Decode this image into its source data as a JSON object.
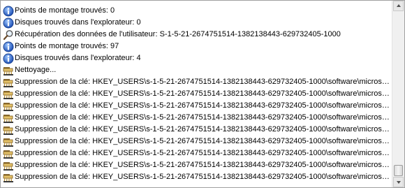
{
  "log": {
    "entries": [
      {
        "icon": "info-icon",
        "text": "Points de montage trouvés: 0"
      },
      {
        "icon": "info-icon",
        "text": "Disques trouvés dans l'explorateur: 0"
      },
      {
        "icon": "magnifier-icon",
        "text": "Récupération des données de l'utilisateur: S-1-5-21-2674751514-1382138443-629732405-1000"
      },
      {
        "icon": "info-icon",
        "text": "Points de montage trouvés: 97"
      },
      {
        "icon": "info-icon",
        "text": "Disques trouvés dans l'explorateur: 4"
      },
      {
        "icon": "broom-icon",
        "text": "Nettoyage..."
      },
      {
        "icon": "broom-icon",
        "text": "Suppression de la clé: HKEY_USERS\\s-1-5-21-2674751514-1382138443-629732405-1000\\software\\microsoft..."
      },
      {
        "icon": "broom-icon",
        "text": "Suppression de la clé: HKEY_USERS\\s-1-5-21-2674751514-1382138443-629732405-1000\\software\\microsoft..."
      },
      {
        "icon": "broom-icon",
        "text": "Suppression de la clé: HKEY_USERS\\s-1-5-21-2674751514-1382138443-629732405-1000\\software\\microsoft..."
      },
      {
        "icon": "broom-icon",
        "text": "Suppression de la clé: HKEY_USERS\\s-1-5-21-2674751514-1382138443-629732405-1000\\software\\microsoft..."
      },
      {
        "icon": "broom-icon",
        "text": "Suppression de la clé: HKEY_USERS\\s-1-5-21-2674751514-1382138443-629732405-1000\\software\\microsoft..."
      },
      {
        "icon": "broom-icon",
        "text": "Suppression de la clé: HKEY_USERS\\s-1-5-21-2674751514-1382138443-629732405-1000\\software\\microsoft..."
      },
      {
        "icon": "broom-icon",
        "text": "Suppression de la clé: HKEY_USERS\\s-1-5-21-2674751514-1382138443-629732405-1000\\software\\microsoft..."
      },
      {
        "icon": "broom-icon",
        "text": "Suppression de la clé: HKEY_USERS\\s-1-5-21-2674751514-1382138443-629732405-1000\\software\\microsoft..."
      },
      {
        "icon": "broom-icon",
        "text": "Suppression de la clé: HKEY_USERS\\s-1-5-21-2674751514-1382138443-629732405-1000\\software\\microsoft..."
      }
    ]
  },
  "scrollbar": {
    "position_fraction": 1.0
  },
  "colors": {
    "info_icon": "#2a5fc4",
    "text": "#000000",
    "border": "#a0a0a0"
  }
}
